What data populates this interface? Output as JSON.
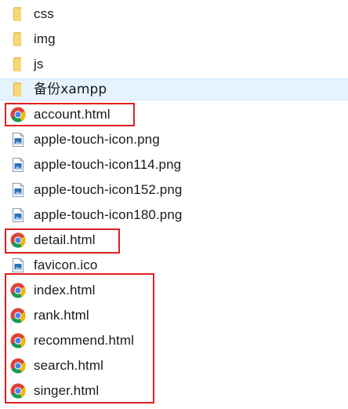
{
  "files": [
    {
      "name": "css",
      "icon": "folder-icon",
      "type": "folder"
    },
    {
      "name": "img",
      "icon": "folder-icon",
      "type": "folder"
    },
    {
      "name": "js",
      "icon": "folder-icon",
      "type": "folder"
    },
    {
      "name": "备份xampp",
      "icon": "folder-icon",
      "type": "folder",
      "selected": true
    },
    {
      "name": "account.html",
      "icon": "chrome-icon",
      "type": "html"
    },
    {
      "name": "apple-touch-icon.png",
      "icon": "image-file-icon",
      "type": "png"
    },
    {
      "name": "apple-touch-icon114.png",
      "icon": "image-file-icon",
      "type": "png"
    },
    {
      "name": "apple-touch-icon152.png",
      "icon": "image-file-icon",
      "type": "png"
    },
    {
      "name": "apple-touch-icon180.png",
      "icon": "image-file-icon",
      "type": "png"
    },
    {
      "name": "detail.html",
      "icon": "chrome-icon",
      "type": "html"
    },
    {
      "name": "favicon.ico",
      "icon": "image-file-icon",
      "type": "ico"
    },
    {
      "name": "index.html",
      "icon": "chrome-icon",
      "type": "html"
    },
    {
      "name": "rank.html",
      "icon": "chrome-icon",
      "type": "html"
    },
    {
      "name": "recommend.html",
      "icon": "chrome-icon",
      "type": "html"
    },
    {
      "name": "search.html",
      "icon": "chrome-icon",
      "type": "html"
    },
    {
      "name": "singer.html",
      "icon": "chrome-icon",
      "type": "html"
    }
  ],
  "colors": {
    "highlight_border": "#e02020",
    "selection_background": "#e5f3ff",
    "folder": "#f8d775"
  }
}
